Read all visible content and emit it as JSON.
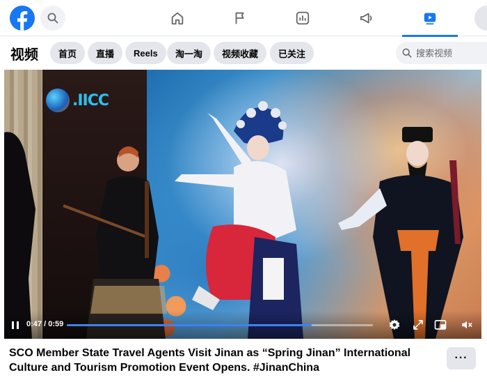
{
  "nav": {
    "logo": "facebook-logo",
    "tabs": [
      "home",
      "pages",
      "dashboard",
      "ads",
      "video"
    ],
    "active_tab": "video",
    "accent": "#1877f2"
  },
  "header": {
    "title": "视频",
    "chips": [
      "首页",
      "直播",
      "Reels",
      "淘一淘",
      "视频收藏",
      "已关注"
    ],
    "search_placeholder": "搜索视频"
  },
  "video": {
    "watermark_text": ".IICC",
    "current_time": "0:47",
    "separator": "/",
    "duration": "0:59",
    "progress_fraction": 0.8
  },
  "post": {
    "caption": "SCO Member State Travel Agents Visit Jinan as “Spring Jinan” International Culture and Tourism Promotion Event Opens. #JinanChina",
    "more_label": "···"
  }
}
